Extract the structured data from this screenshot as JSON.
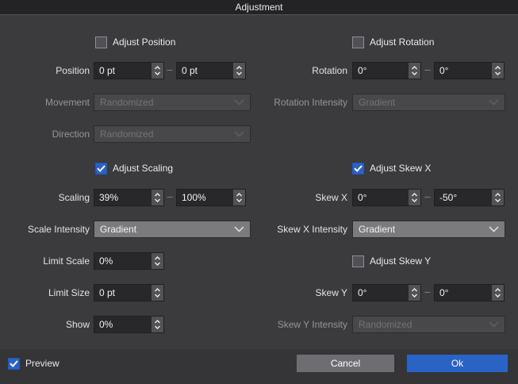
{
  "title": "Adjustment",
  "range_separator": "–",
  "colors": {
    "accent_blue": "#2a63c6",
    "cancel_gray": "#6e6e72",
    "panel_bg": "#3b3b3e",
    "titlebar_bg": "#232325",
    "field_bg": "#28282a",
    "dropdown_bg": "#7b7b7e",
    "dropdown_disabled_bg": "#48484b"
  },
  "left": {
    "adjust_position": {
      "label": "Adjust Position",
      "checked": false
    },
    "position": {
      "label": "Position",
      "from": "0 pt",
      "to": "0 pt"
    },
    "movement": {
      "label": "Movement",
      "value": "Randomized",
      "disabled": true
    },
    "direction": {
      "label": "Direction",
      "value": "Randomized",
      "disabled": true
    },
    "adjust_scaling": {
      "label": "Adjust Scaling",
      "checked": true
    },
    "scaling": {
      "label": "Scaling",
      "from": "39%",
      "to": "100%"
    },
    "scale_intensity": {
      "label": "Scale Intensity",
      "value": "Gradient",
      "disabled": false
    },
    "limit_scale": {
      "label": "Limit Scale",
      "value": "0%"
    },
    "limit_size": {
      "label": "Limit Size",
      "value": "0 pt"
    },
    "show": {
      "label": "Show",
      "value": "0%"
    }
  },
  "right": {
    "adjust_rotation": {
      "label": "Adjust Rotation",
      "checked": false
    },
    "rotation": {
      "label": "Rotation",
      "from": "0°",
      "to": "0°"
    },
    "rotation_intensity": {
      "label": "Rotation Intensity",
      "value": "Gradient",
      "disabled": true
    },
    "adjust_skew_x": {
      "label": "Adjust Skew X",
      "checked": true
    },
    "skew_x": {
      "label": "Skew X",
      "from": "0°",
      "to": "-50°"
    },
    "skew_x_intensity": {
      "label": "Skew X Intensity",
      "value": "Gradient",
      "disabled": false
    },
    "adjust_skew_y": {
      "label": "Adjust Skew Y",
      "checked": false
    },
    "skew_y": {
      "label": "Skew Y",
      "from": "0°",
      "to": "0°"
    },
    "skew_y_intensity": {
      "label": "Skew Y Intensity",
      "value": "Randomized",
      "disabled": true
    }
  },
  "footer": {
    "preview": {
      "label": "Preview",
      "checked": true
    },
    "cancel_label": "Cancel",
    "ok_label": "Ok"
  }
}
